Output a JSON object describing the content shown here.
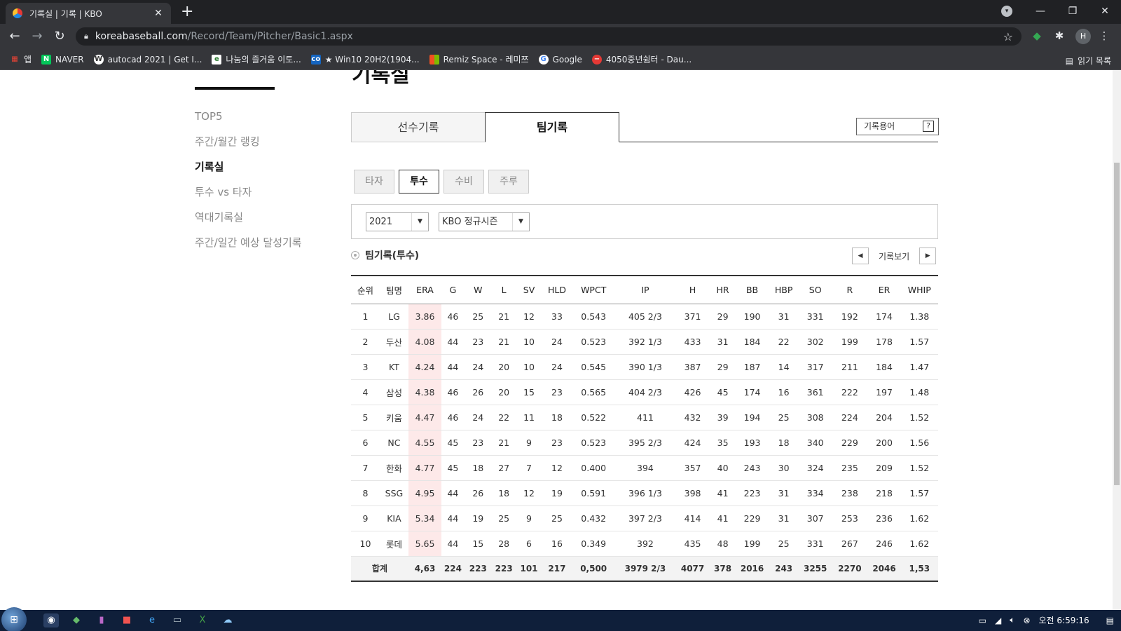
{
  "browser": {
    "tab_title": "기록실 | 기록 | KBO",
    "url_host": "koreabaseball.com",
    "url_path": "/Record/Team/Pitcher/Basic1.aspx",
    "profile_initial": "H",
    "bookmarks": [
      {
        "label": "앱",
        "icon": "apps-grid-icon"
      },
      {
        "label": "NAVER",
        "icon": "naver-icon"
      },
      {
        "label": "autocad 2021 | Get I...",
        "icon": "wordpress-icon"
      },
      {
        "label": "나눔의 즐거움 이토...",
        "icon": "e-icon"
      },
      {
        "label": "★ Win10 20H2(1904...",
        "icon": "cc-icon"
      },
      {
        "label": "Remiz Space - 레미쯔",
        "icon": "windows-icon"
      },
      {
        "label": "Google",
        "icon": "google-icon"
      },
      {
        "label": "4050중년쉼터 - Dau...",
        "icon": "daum-icon"
      }
    ],
    "reading_list": "읽기 목록"
  },
  "page": {
    "heading": "기록실",
    "sidebar": [
      {
        "label": "TOP5",
        "active": false
      },
      {
        "label": "주간/월간 랭킹",
        "active": false
      },
      {
        "label": "기록실",
        "active": true
      },
      {
        "label": "투수 vs 타자",
        "active": false
      },
      {
        "label": "역대기록실",
        "active": false
      },
      {
        "label": "주간/일간 예상 달성기록",
        "active": false
      }
    ],
    "main_tabs": [
      {
        "label": "선수기록",
        "active": false
      },
      {
        "label": "팀기록",
        "active": true
      }
    ],
    "glossary_label": "기록용어",
    "glossary_help": "?",
    "sub_tabs": [
      {
        "label": "타자",
        "active": false
      },
      {
        "label": "투수",
        "active": true
      },
      {
        "label": "수비",
        "active": false
      },
      {
        "label": "주루",
        "active": false
      }
    ],
    "year_select": "2021",
    "season_select": "KBO 정규시즌",
    "section_title": "팀기록(투수)",
    "pager_label": "기록보기",
    "table": {
      "headers": [
        "순위",
        "팀명",
        "ERA",
        "G",
        "W",
        "L",
        "SV",
        "HLD",
        "WPCT",
        "IP",
        "H",
        "HR",
        "BB",
        "HBP",
        "SO",
        "R",
        "ER",
        "WHIP"
      ],
      "rows": [
        [
          "1",
          "LG",
          "3.86",
          "46",
          "25",
          "21",
          "12",
          "33",
          "0.543",
          "405 2/3",
          "371",
          "29",
          "190",
          "31",
          "331",
          "192",
          "174",
          "1.38"
        ],
        [
          "2",
          "두산",
          "4.08",
          "44",
          "23",
          "21",
          "10",
          "24",
          "0.523",
          "392 1/3",
          "433",
          "31",
          "184",
          "22",
          "302",
          "199",
          "178",
          "1.57"
        ],
        [
          "3",
          "KT",
          "4.24",
          "44",
          "24",
          "20",
          "10",
          "24",
          "0.545",
          "390 1/3",
          "387",
          "29",
          "187",
          "14",
          "317",
          "211",
          "184",
          "1.47"
        ],
        [
          "4",
          "삼성",
          "4.38",
          "46",
          "26",
          "20",
          "15",
          "23",
          "0.565",
          "404 2/3",
          "426",
          "45",
          "174",
          "16",
          "361",
          "222",
          "197",
          "1.48"
        ],
        [
          "5",
          "키움",
          "4.47",
          "46",
          "24",
          "22",
          "11",
          "18",
          "0.522",
          "411",
          "432",
          "39",
          "194",
          "25",
          "308",
          "224",
          "204",
          "1.52"
        ],
        [
          "6",
          "NC",
          "4.55",
          "45",
          "23",
          "21",
          "9",
          "23",
          "0.523",
          "395 2/3",
          "424",
          "35",
          "193",
          "18",
          "340",
          "229",
          "200",
          "1.56"
        ],
        [
          "7",
          "한화",
          "4.77",
          "45",
          "18",
          "27",
          "7",
          "12",
          "0.400",
          "394",
          "357",
          "40",
          "243",
          "30",
          "324",
          "235",
          "209",
          "1.52"
        ],
        [
          "8",
          "SSG",
          "4.95",
          "44",
          "26",
          "18",
          "12",
          "19",
          "0.591",
          "396 1/3",
          "398",
          "41",
          "223",
          "31",
          "334",
          "238",
          "218",
          "1.57"
        ],
        [
          "9",
          "KIA",
          "5.34",
          "44",
          "19",
          "25",
          "9",
          "25",
          "0.432",
          "397 2/3",
          "414",
          "41",
          "229",
          "31",
          "307",
          "253",
          "236",
          "1.62"
        ],
        [
          "10",
          "롯데",
          "5.65",
          "44",
          "15",
          "28",
          "6",
          "16",
          "0.349",
          "392",
          "435",
          "48",
          "199",
          "25",
          "331",
          "267",
          "246",
          "1.62"
        ]
      ],
      "footer": [
        "합계",
        "4,63",
        "224",
        "223",
        "223",
        "101",
        "217",
        "0,500",
        "3979 2/3",
        "4077",
        "378",
        "2016",
        "243",
        "3255",
        "2270",
        "2046",
        "1,53"
      ]
    }
  },
  "taskbar": {
    "time": "오전 6:59:16"
  }
}
